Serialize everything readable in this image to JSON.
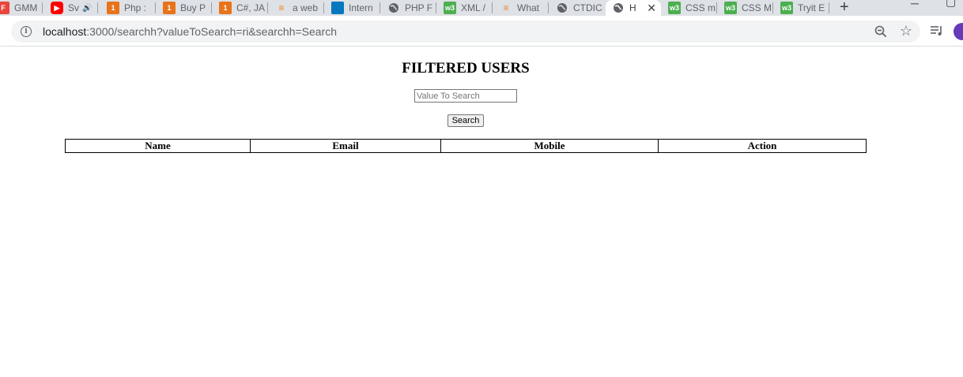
{
  "browser": {
    "tabs": [
      {
        "label": "GMM",
        "icon": "flipboard-icon"
      },
      {
        "label": "Sv",
        "icon": "youtube-icon"
      },
      {
        "label": "Php :",
        "icon": "orange-app-icon"
      },
      {
        "label": "Buy P",
        "icon": "orange-app-icon"
      },
      {
        "label": "C#, JA",
        "icon": "orange-app-icon"
      },
      {
        "label": "a web",
        "icon": "stackoverflow-icon"
      },
      {
        "label": "Intern",
        "icon": "drupal-icon"
      },
      {
        "label": "PHP F",
        "icon": "globe-icon"
      },
      {
        "label": "XML /",
        "icon": "w3schools-icon"
      },
      {
        "label": "What",
        "icon": "stackoverflow-icon"
      },
      {
        "label": "CTDIC",
        "icon": "globe-icon"
      },
      {
        "label": "H",
        "icon": "globe-icon",
        "active": true
      },
      {
        "label": "CSS m",
        "icon": "w3schools-icon"
      },
      {
        "label": "CSS M",
        "icon": "w3schools-icon"
      },
      {
        "label": "Tryit E",
        "icon": "w3schools-icon"
      }
    ],
    "new_tab": "+",
    "url_host": "localhost",
    "url_path": ":3000/searchh?valueToSearch=ri&searchh=Search"
  },
  "page": {
    "title": "FILTERED USERS",
    "search_placeholder": "Value To Search",
    "search_button": "Search",
    "table_headers": [
      "Name",
      "Email",
      "Mobile",
      "Action"
    ]
  }
}
